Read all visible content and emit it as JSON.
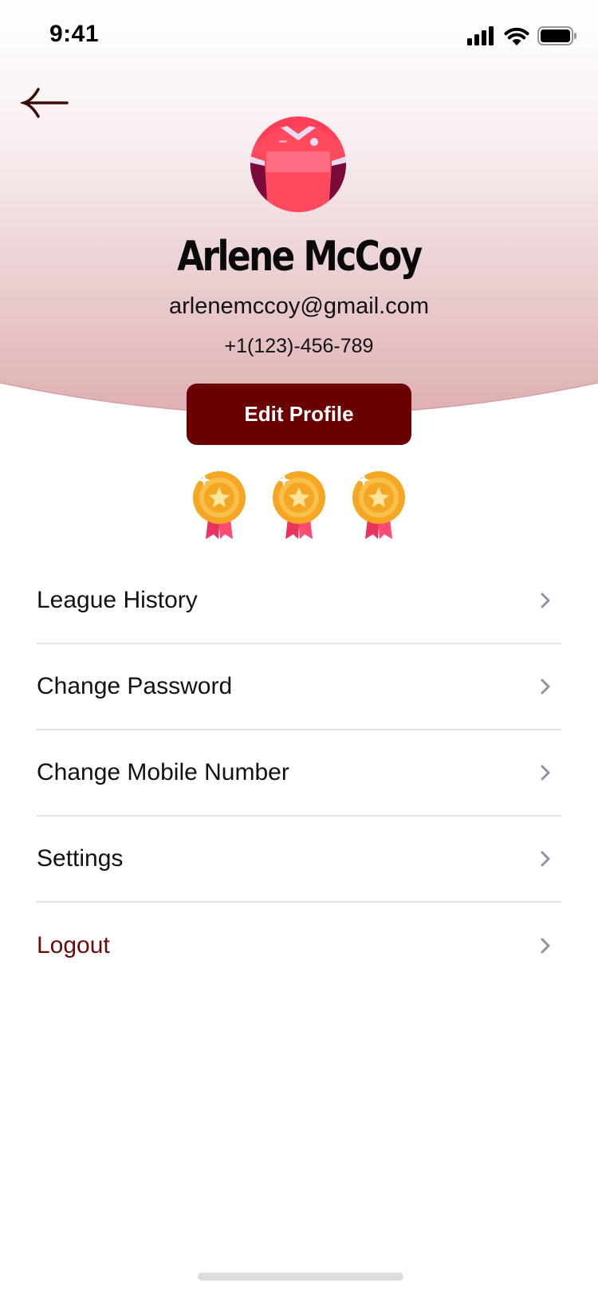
{
  "status_bar": {
    "time": "9:41",
    "icons": [
      "signal-icon",
      "wifi-icon",
      "battery-icon"
    ]
  },
  "header": {
    "back_icon": "arrow-left-icon",
    "avatar_icon": "jersey-icon"
  },
  "profile": {
    "name": "Arlene McCoy",
    "email": "arlenemccoy@gmail.com",
    "phone": "+1(123)-456-789",
    "edit_button_label": "Edit Profile"
  },
  "medals": {
    "count": 3,
    "icon": "medal-icon"
  },
  "menu": {
    "items": [
      {
        "label": "League History"
      },
      {
        "label": "Change Password"
      },
      {
        "label": "Change Mobile Number"
      },
      {
        "label": "Settings"
      },
      {
        "label": "Logout"
      }
    ]
  },
  "colors": {
    "accent": "#6b0000",
    "logout_text": "#6b0a0a",
    "header_gradient_bottom": "#e2b3b6",
    "divider": "#e3e3e6",
    "chevron": "#8a94a6"
  }
}
